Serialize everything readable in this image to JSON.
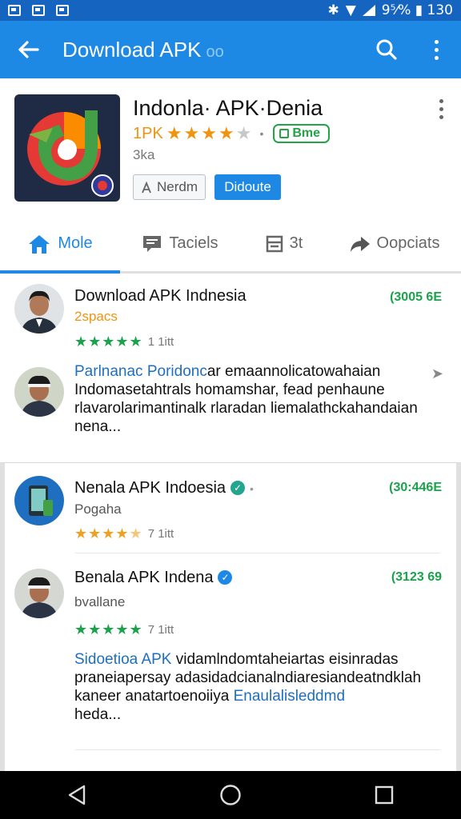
{
  "status_bar": {
    "right_text": "9⁵⁄% ▮ 130"
  },
  "app_bar": {
    "title": "Download APK",
    "title_suffix": "oo"
  },
  "app": {
    "name": "Indonla· APK·Denia",
    "rating_text": "1PK",
    "rating_stars": 4,
    "store_badge": "Bme",
    "size": "3ka",
    "button_secondary": "Nerdm",
    "button_primary": "Didoute"
  },
  "tabs": [
    {
      "label": "Mole",
      "icon": "home-icon",
      "active": true
    },
    {
      "label": "Taciels",
      "icon": "chat-icon",
      "active": false
    },
    {
      "label": "3t",
      "icon": "list-icon",
      "active": false
    },
    {
      "label": "Oopciats",
      "icon": "share-icon",
      "active": false
    }
  ],
  "reviews": [
    {
      "title": "Download APK Indnesia",
      "subtitle": "2spacs",
      "stars": 5,
      "count": "1 1itt",
      "badge": "(3005 6E",
      "body_lead": "Parlnanac Poridonc",
      "body_line1_rest": "ar emaannolicatowahaian",
      "body_line2": "Indomasetahtrals homamshar, fead penhaune",
      "body_line3": "rlavarolarimantinalk rlaradan liemalathckahandaian",
      "body_line4": "nena..."
    },
    {
      "title": "Nenala APK Indoesia",
      "subtitle": "Pogaha",
      "stars": 4,
      "count": "7 1itt",
      "badge": "(30:446E"
    },
    {
      "title": "Benala APK Indena",
      "subtitle": "bvallane",
      "stars": 5,
      "count": "7 1itt",
      "badge": "(3123 69",
      "body_lead": "Sidoetioa APK",
      "body_line1_rest": "vidamlndomtaheiartas eisinradas",
      "body_line2": "praneiapersay adasidadcianalndiaresiandeatndklah",
      "body_line3_plain": "kaneer anatartoenoiiya",
      "body_line3_link": "Enaulalisleddmd",
      "body_line4": "heda..."
    }
  ],
  "colors": {
    "primary": "#1e88e5",
    "status_bar": "#1565c0",
    "green": "#1aa34a",
    "orange": "#f09410"
  }
}
